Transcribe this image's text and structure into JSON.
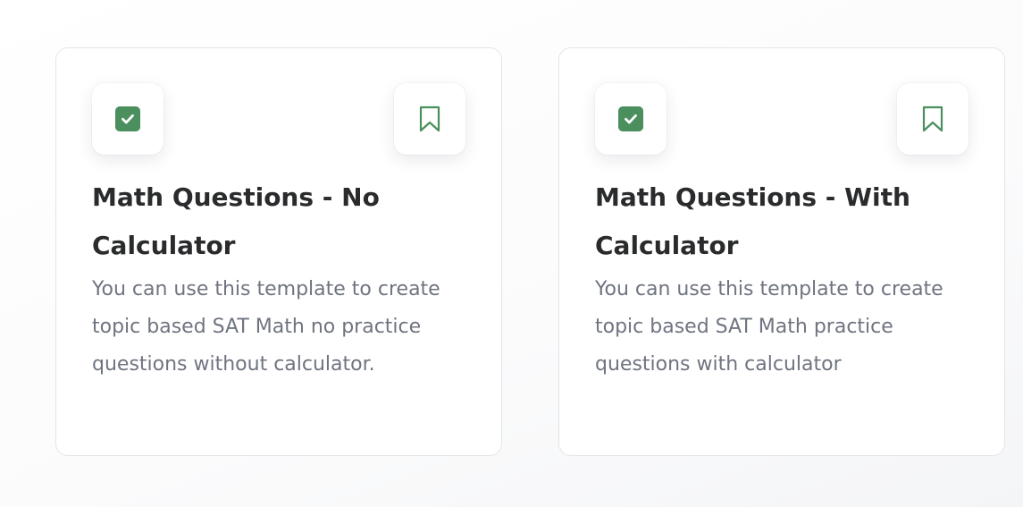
{
  "colors": {
    "accent_green": "#4a8f5d",
    "title_text": "#2a2b2d",
    "body_text": "#6f7480",
    "card_border": "#e4e5e8"
  },
  "cards": [
    {
      "title": "Math Questions - No Calculator",
      "description": "You can use this template to create topic based SAT Math no practice questions without calculator.",
      "select_icon": "checkbox-checked-icon",
      "save_icon": "bookmark-icon"
    },
    {
      "title": "Math Questions - With Calculator",
      "description": "You can use this template to create topic based SAT Math practice questions with calculator",
      "select_icon": "checkbox-checked-icon",
      "save_icon": "bookmark-icon"
    }
  ]
}
